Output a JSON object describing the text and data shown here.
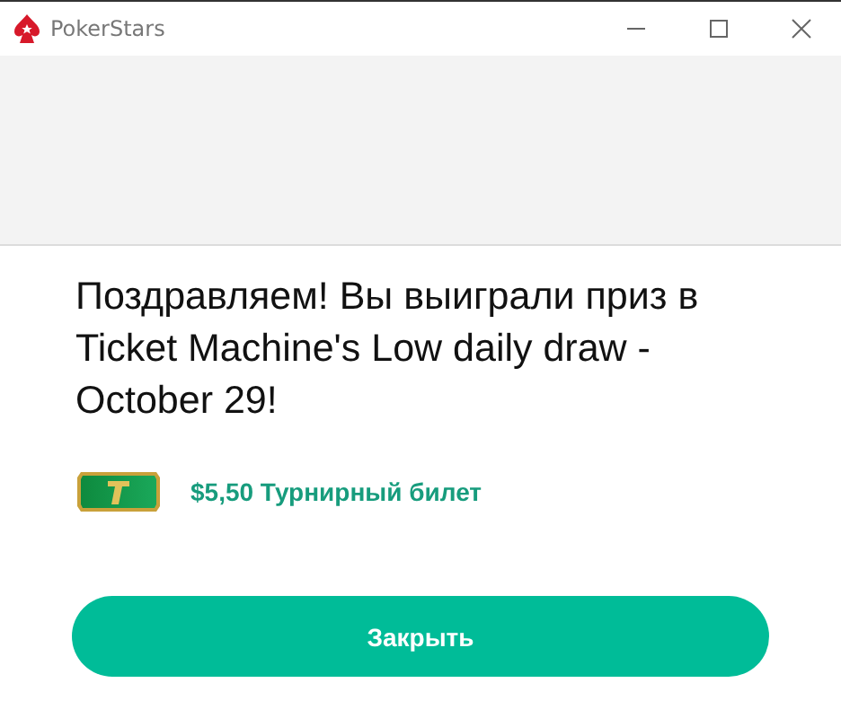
{
  "window": {
    "title": "PokerStars"
  },
  "message": "Поздравляем! Вы выиграли приз в Ticket Machine's Low daily draw - October 29!",
  "prize": {
    "label": "$5,50 Турнирный билет"
  },
  "buttons": [
    "Закрыть"
  ]
}
